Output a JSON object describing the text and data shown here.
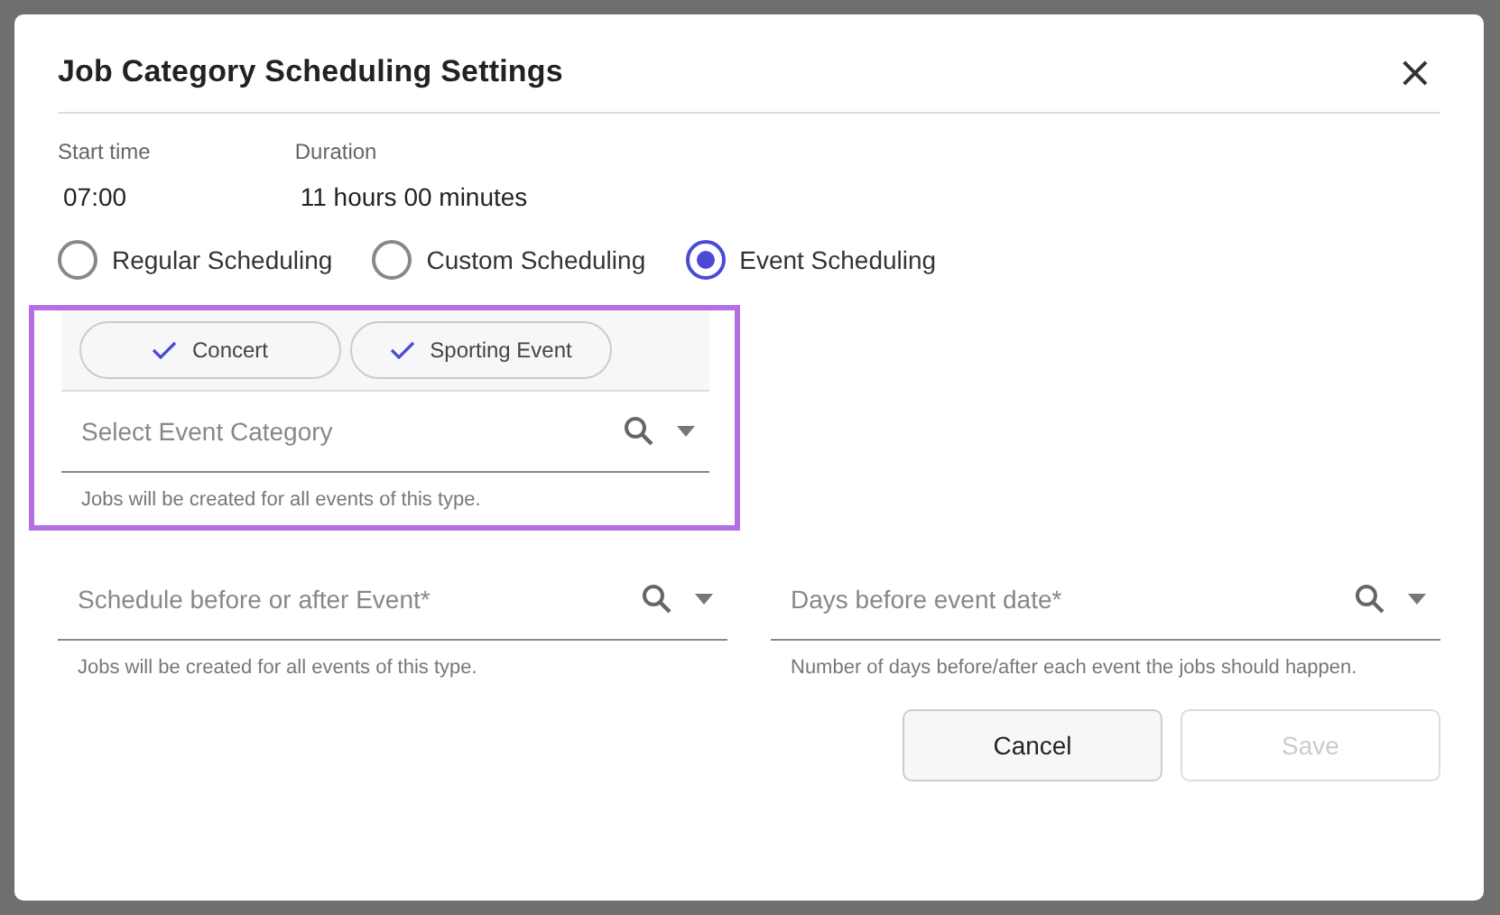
{
  "dialog": {
    "title": "Job Category Scheduling Settings",
    "close_label": "×"
  },
  "summary": [
    {
      "label": "Start time",
      "value": "07:00"
    },
    {
      "label": "Duration",
      "value": "11 hours 00 minutes"
    }
  ],
  "scheduling_options": [
    {
      "label": "Regular Scheduling",
      "selected": false
    },
    {
      "label": "Custom Scheduling",
      "selected": false
    },
    {
      "label": "Event Scheduling",
      "selected": true
    }
  ],
  "event_category": {
    "highlighted": true,
    "chips": [
      {
        "label": "Concert",
        "checked": true
      },
      {
        "label": "Sporting Event",
        "checked": true
      }
    ],
    "placeholder": "Select Event Category",
    "helper": "Jobs will be created for all events of this type."
  },
  "fields": [
    {
      "placeholder": "Schedule before or after Event*",
      "helper": "Jobs will be created for all events of this type."
    },
    {
      "placeholder": "Days before event date*",
      "helper": "Number of days before/after each event the jobs should happen."
    }
  ],
  "buttons": [
    {
      "label": "Cancel",
      "disabled": false
    },
    {
      "label": "Save",
      "disabled": true
    }
  ]
}
